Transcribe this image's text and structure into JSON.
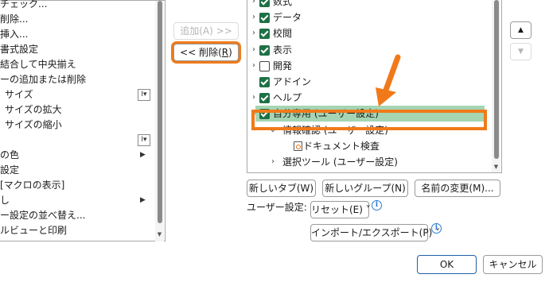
{
  "left_list": {
    "items": [
      {
        "label": "チェック...",
        "indent": 0,
        "suffix": ""
      },
      {
        "label": "削除...",
        "indent": 0,
        "suffix": ""
      },
      {
        "label": "挿入...",
        "indent": 0,
        "suffix": ""
      },
      {
        "label": "書式設定",
        "indent": 0,
        "suffix": ""
      },
      {
        "label": "結合して中央揃え",
        "indent": 0,
        "suffix": ""
      },
      {
        "label": "ーの追加または削除",
        "indent": 0,
        "suffix": ""
      },
      {
        "label": "サイズ",
        "indent": 1,
        "suffix": "I▾"
      },
      {
        "label": "サイズの拡大",
        "indent": 1,
        "suffix": ""
      },
      {
        "label": "サイズの縮小",
        "indent": 1,
        "suffix": ""
      },
      {
        "label": "",
        "indent": 1,
        "suffix": "I▾"
      },
      {
        "label": "の色",
        "indent": 0,
        "suffix": "▶"
      },
      {
        "label": "設定",
        "indent": 0,
        "suffix": ""
      },
      {
        "label": "[マクロの表示]",
        "indent": 0,
        "suffix": ""
      },
      {
        "label": "し",
        "indent": 0,
        "suffix": "▶"
      },
      {
        "label": "ー設定の並べ替え...",
        "indent": 0,
        "suffix": ""
      },
      {
        "label": "ルビューと印刷",
        "indent": 0,
        "suffix": ""
      }
    ]
  },
  "middle": {
    "add_label": "追加(A) >>",
    "add_hotkey": "A",
    "remove_prefix": "<< 削除(",
    "remove_hotkey": "R",
    "remove_suffix": ")"
  },
  "tree": {
    "items": [
      {
        "label": "数式",
        "checked": true,
        "expander": "›",
        "level": 0
      },
      {
        "label": "データ",
        "checked": true,
        "expander": "›",
        "level": 0
      },
      {
        "label": "校閲",
        "checked": true,
        "expander": "›",
        "level": 0
      },
      {
        "label": "表示",
        "checked": true,
        "expander": "›",
        "level": 0
      },
      {
        "label": "開発",
        "checked": false,
        "expander": "›",
        "level": 0
      },
      {
        "label": "アドイン",
        "checked": true,
        "expander": "",
        "level": 0
      },
      {
        "label": "ヘルプ",
        "checked": true,
        "expander": "›",
        "level": 0
      },
      {
        "label": "自分専用 (ユーザー設定)",
        "checked": true,
        "expander": "⌄",
        "level": 0,
        "selected": true
      },
      {
        "label": "情報確認 (ユーザー設定)",
        "checked": null,
        "expander": "⌄",
        "level": 1
      },
      {
        "label": "ドキュメント検査",
        "checked": null,
        "expander": "",
        "level": 2,
        "icon": "inspect-document-icon"
      },
      {
        "label": "選択ツール (ユーザー設定)",
        "checked": null,
        "expander": "›",
        "level": 1
      }
    ]
  },
  "buttons": {
    "new_tab": "新しいタブ(W)",
    "new_group": "新しいグループ(N)",
    "rename": "名前の変更(M)...",
    "custom_label": "ユーザー設定:",
    "reset": "リセット(E) ˅",
    "import_export": "インポート/エクスポート(P) ˅",
    "ok": "OK",
    "cancel": "キャンセル",
    "move_up": "▲",
    "move_down": "▼"
  },
  "colors": {
    "accent_orange": "#f07a1a",
    "excel_green": "#1e7145",
    "selection_green": "#a6d5b4"
  }
}
